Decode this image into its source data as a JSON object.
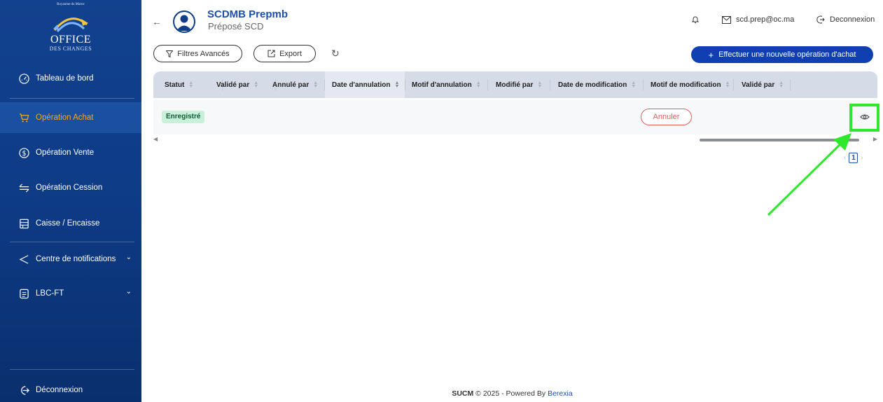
{
  "sidebar": {
    "logo": {
      "top_line": "Royaume du Maroc",
      "name": "OFFICE",
      "subname": "DES CHANGES"
    },
    "items": [
      {
        "label": "Tableau de bord",
        "icon": "dashboard-gauge-icon"
      },
      {
        "label": "Opération Achat",
        "icon": "shopping-cart-icon",
        "active": true
      },
      {
        "label": "Opération Vente",
        "icon": "dollar-circle-icon"
      },
      {
        "label": "Opération Cession",
        "icon": "swap-arrows-icon"
      },
      {
        "label": "Caisse / Encaisse",
        "icon": "cash-register-icon"
      },
      {
        "label": "Centre de notifications",
        "icon": "megaphone-icon"
      },
      {
        "label": "LBC-FT",
        "icon": "document-icon"
      }
    ],
    "logout_label": "Déconnexion"
  },
  "header": {
    "user_name": "SCDMB Prepmb",
    "user_role": "Préposé SCD",
    "email": "scd.prep@oc.ma",
    "logout_label": "Deconnexion"
  },
  "toolbar": {
    "filters_label": "Filtres Avancés",
    "export_label": "Export",
    "new_operation_label": "Effectuer une nouvelle opération d'achat"
  },
  "table": {
    "columns": [
      "Statut",
      "Validé par",
      "Annulé par",
      "Date d'annulation",
      "Motif d'annulation",
      "Modifié par",
      "Date de modification",
      "Motif de modification",
      "Validé par"
    ],
    "rows": [
      {
        "statut": "Enregistré",
        "action_label": "Annuler"
      }
    ]
  },
  "pagination": {
    "current_page": "1"
  },
  "footer": {
    "product": "SUCM",
    "text": "© 2025 - Powered By",
    "brand": "Berexia"
  },
  "colors": {
    "sidebar": "#0e3b86",
    "accent": "#f5a623",
    "primary": "#0f3fb0",
    "highlight": "#2ee82e",
    "danger": "#e8595a"
  }
}
